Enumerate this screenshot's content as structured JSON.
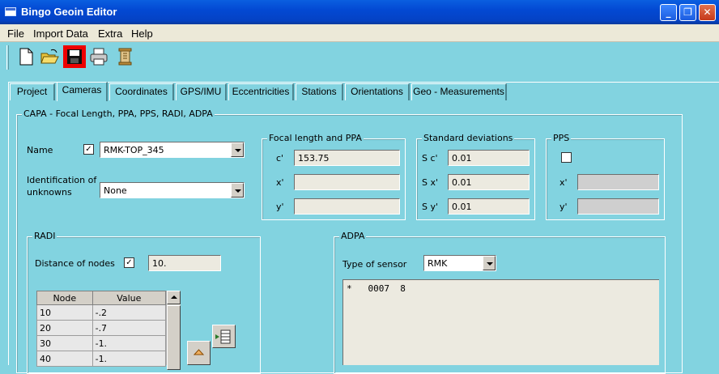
{
  "window": {
    "title": "Bingo Geoin Editor",
    "controls": {
      "minimize": "_",
      "maximize": "❐",
      "close": "✕"
    }
  },
  "menu": [
    "File",
    "Import Data",
    "Extra",
    "Help"
  ],
  "toolbar": {
    "icons": [
      "new-file-icon",
      "open-folder-icon",
      "save-icon",
      "print-icon",
      "scroll-document-icon"
    ],
    "active": "save-icon"
  },
  "tabs": [
    "Project",
    "Cameras",
    "Coordinates",
    "GPS/IMU",
    "Eccentricities",
    "Stations",
    "Orientations",
    "Geo - Measurements"
  ],
  "selected_tab": "Cameras",
  "capa": {
    "legend": "CAPA - Focal Length, PPA, PPS, RADI, ADPA",
    "name_label": "Name",
    "name_checked": true,
    "name_value": "RMK-TOP_345",
    "ident_label_1": "Identification of",
    "ident_label_2": "unknowns",
    "ident_value": "None",
    "focal": {
      "legend": "Focal length and PPA",
      "rows": [
        {
          "label": "c'",
          "value": "153.75"
        },
        {
          "label": "x'",
          "value": ""
        },
        {
          "label": "y'",
          "value": ""
        }
      ]
    },
    "std": {
      "legend": "Standard deviations",
      "rows": [
        {
          "label": "S c'",
          "value": "0.01"
        },
        {
          "label": "S x'",
          "value": "0.01"
        },
        {
          "label": "S y'",
          "value": "0.01"
        }
      ]
    },
    "pps": {
      "legend": "PPS",
      "checked": false,
      "rows": [
        {
          "label": "x'",
          "value": ""
        },
        {
          "label": "y'",
          "value": ""
        }
      ]
    }
  },
  "radi": {
    "legend": "RADI",
    "distance_label": "Distance of nodes",
    "distance_checked": true,
    "distance_value": "10.",
    "columns": [
      "Node",
      "Value"
    ],
    "rows": [
      {
        "node": "10",
        "value": "-.2"
      },
      {
        "node": "20",
        "value": "-.7"
      },
      {
        "node": "30",
        "value": "-1."
      },
      {
        "node": "40",
        "value": "-1."
      }
    ]
  },
  "adpa": {
    "legend": "ADPA",
    "sensor_label": "Type of sensor",
    "sensor_value": "RMK",
    "text": "*   0007  8"
  },
  "colors": {
    "background": "#82d3e0",
    "titlebar": "#0349d3",
    "active_tool": "#e00000"
  }
}
